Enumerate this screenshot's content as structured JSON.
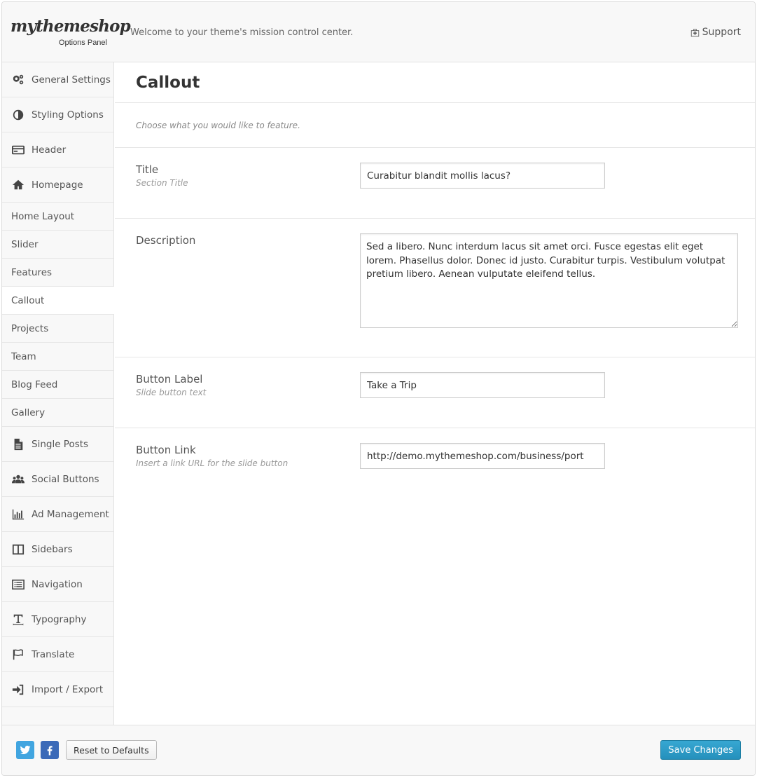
{
  "header": {
    "logo": "mythemeshop",
    "logo_sub": "Options Panel",
    "welcome": "Welcome to your theme's mission control center.",
    "support": "Support"
  },
  "sidebar": {
    "items": [
      {
        "label": "General Settings",
        "icon": "gears-icon"
      },
      {
        "label": "Styling Options",
        "icon": "contrast-icon"
      },
      {
        "label": "Header",
        "icon": "card-icon"
      },
      {
        "label": "Homepage",
        "icon": "home-icon"
      },
      {
        "label": "Home Layout"
      },
      {
        "label": "Slider"
      },
      {
        "label": "Features"
      },
      {
        "label": "Callout"
      },
      {
        "label": "Projects"
      },
      {
        "label": "Team"
      },
      {
        "label": "Blog Feed"
      },
      {
        "label": "Gallery"
      },
      {
        "label": "Single Posts",
        "icon": "document-icon"
      },
      {
        "label": "Social Buttons",
        "icon": "users-icon"
      },
      {
        "label": "Ad Management",
        "icon": "bar-chart-icon"
      },
      {
        "label": "Sidebars",
        "icon": "columns-icon"
      },
      {
        "label": "Navigation",
        "icon": "list-icon"
      },
      {
        "label": "Typography",
        "icon": "text-icon"
      },
      {
        "label": "Translate",
        "icon": "flag-icon"
      },
      {
        "label": "Import / Export",
        "icon": "sign-in-icon"
      }
    ],
    "active": "Callout"
  },
  "section": {
    "title": "Callout",
    "description": "Choose what you would like to feature."
  },
  "fields": {
    "title": {
      "label": "Title",
      "hint": "Section Title",
      "value": "Curabitur blandit mollis lacus?"
    },
    "description": {
      "label": "Description",
      "value": "Sed a libero. Nunc interdum lacus sit amet orci. Fusce egestas elit eget lorem. Phasellus dolor. Donec id justo. Curabitur turpis. Vestibulum volutpat pretium libero. Aenean vulputate eleifend tellus."
    },
    "button_label": {
      "label": "Button Label",
      "hint": "Slide button text",
      "value": "Take a Trip"
    },
    "button_link": {
      "label": "Button Link",
      "hint": "Insert a link URL for the slide button",
      "value": "http://demo.mythemeshop.com/business/port"
    }
  },
  "footer": {
    "reset": "Reset to Defaults",
    "save": "Save Changes"
  },
  "colors": {
    "accent": "#2e9bc9",
    "twitter": "#41a5e0",
    "facebook": "#3b6ab8"
  }
}
